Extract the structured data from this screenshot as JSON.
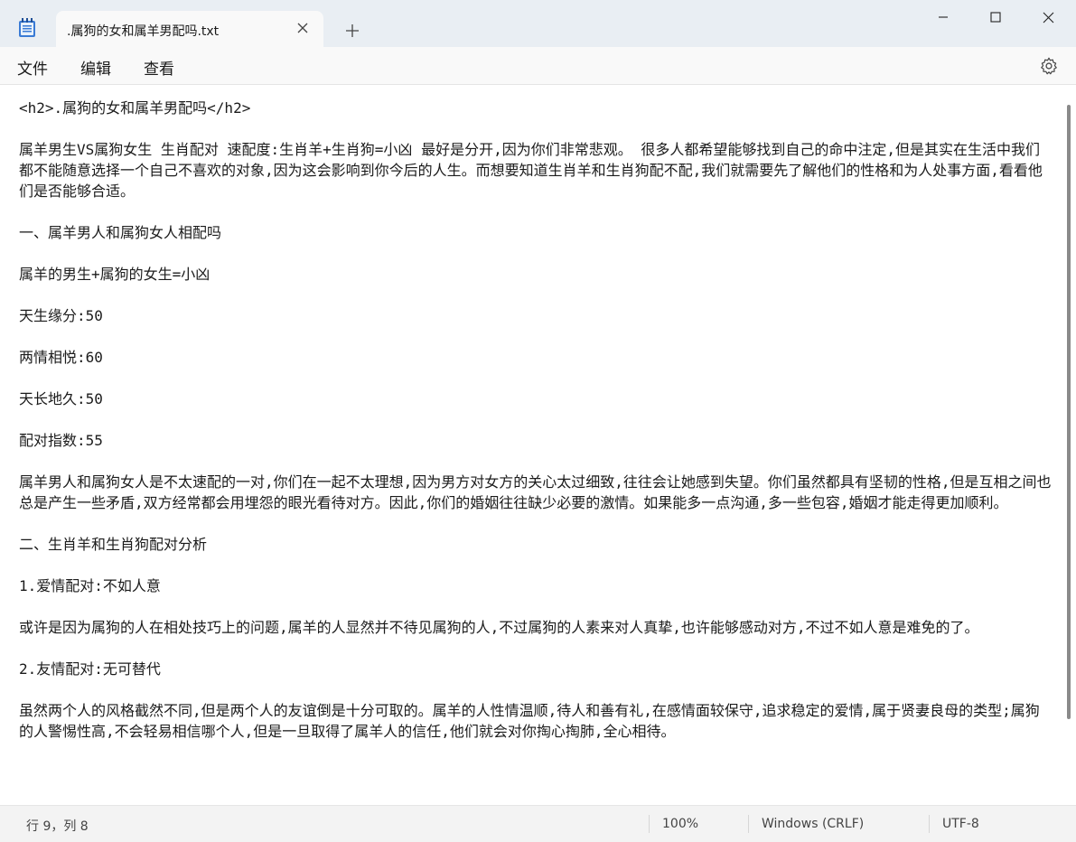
{
  "tab": {
    "title": ".属狗的女和属羊男配吗.txt"
  },
  "menu": {
    "file": "文件",
    "edit": "编辑",
    "view": "查看"
  },
  "content": {
    "lines": [
      "<h2>.属狗的女和属羊男配吗</h2>",
      "属羊男生VS属狗女生 生肖配对 速配度:生肖羊+生肖狗=小凶 最好是分开,因为你们非常悲观。 很多人都希望能够找到自己的命中注定,但是其实在生活中我们都不能随意选择一个自己不喜欢的对象,因为这会影响到你今后的人生。而想要知道生肖羊和生肖狗配不配,我们就需要先了解他们的性格和为人处事方面,看看他们是否能够合适。",
      "一、属羊男人和属狗女人相配吗",
      "属羊的男生+属狗的女生=小凶",
      "天生缘分:50",
      "两情相悦:60",
      "天长地久:50",
      "配对指数:55",
      "属羊男人和属狗女人是不太速配的一对,你们在一起不太理想,因为男方对女方的关心太过细致,往往会让她感到失望。你们虽然都具有坚韧的性格,但是互相之间也总是产生一些矛盾,双方经常都会用埋怨的眼光看待对方。因此,你们的婚姻往往缺少必要的激情。如果能多一点沟通,多一些包容,婚姻才能走得更加顺利。",
      "二、生肖羊和生肖狗配对分析",
      "1.爱情配对:不如人意",
      "或许是因为属狗的人在相处技巧上的问题,属羊的人显然并不待见属狗的人,不过属狗的人素来对人真挚,也许能够感动对方,不过不如人意是难免的了。",
      "2.友情配对:无可替代",
      "虽然两个人的风格截然不同,但是两个人的友谊倒是十分可取的。属羊的人性情温顺,待人和善有礼,在感情面较保守,追求稳定的爱情,属于贤妻良母的类型;属狗的人警惕性高,不会轻易相信哪个人,但是一旦取得了属羊人的信任,他们就会对你掏心掏肺,全心相待。"
    ]
  },
  "status": {
    "position": "行 9，列 8",
    "zoom": "100%",
    "line_ending": "Windows (CRLF)",
    "encoding": "UTF-8"
  }
}
